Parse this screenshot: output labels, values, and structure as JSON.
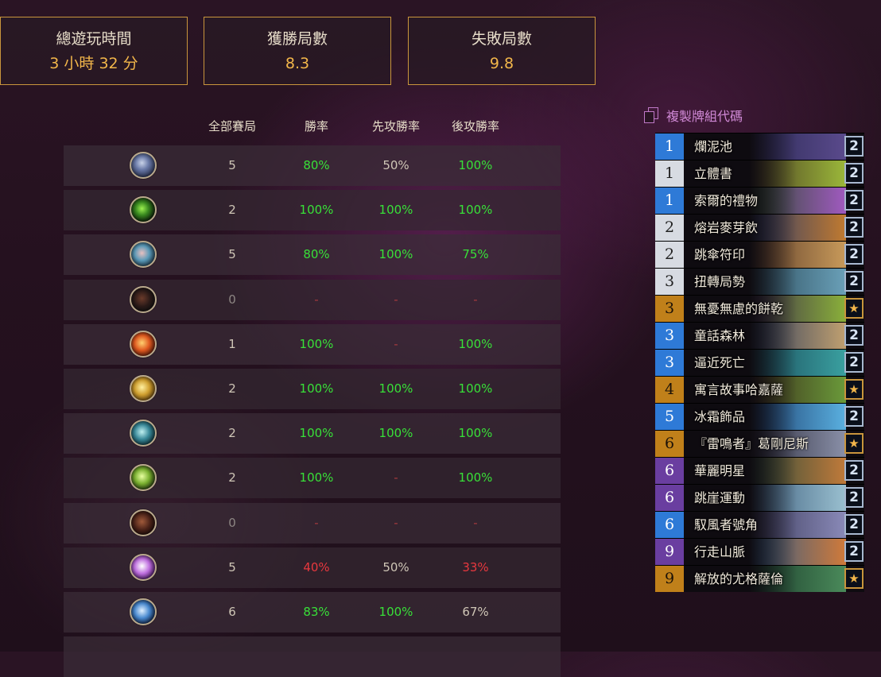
{
  "summary": {
    "total_time": {
      "label": "總遊玩時間",
      "value": "3 小時 32 分"
    },
    "wins": {
      "label": "獲勝局數",
      "value": "8.3"
    },
    "losses": {
      "label": "失敗局數",
      "value": "9.8"
    }
  },
  "table": {
    "headers": [
      "全部賽局",
      "勝率",
      "先攻勝率",
      "後攻勝率"
    ],
    "rows": [
      {
        "icon": "warrior-class-icon",
        "games": "5",
        "winrate": "80%",
        "first": "50%",
        "second": "100%"
      },
      {
        "icon": "druid-class-icon",
        "games": "2",
        "winrate": "100%",
        "first": "100%",
        "second": "100%"
      },
      {
        "icon": "shaman-class-icon",
        "games": "5",
        "winrate": "80%",
        "first": "100%",
        "second": "75%"
      },
      {
        "icon": "rogue-class-icon",
        "games": "0",
        "winrate": "-",
        "first": "-",
        "second": "-"
      },
      {
        "icon": "mage-class-icon",
        "games": "1",
        "winrate": "100%",
        "first": "-",
        "second": "100%"
      },
      {
        "icon": "paladin-class-icon",
        "games": "2",
        "winrate": "100%",
        "first": "100%",
        "second": "100%"
      },
      {
        "icon": "hunter-class-icon",
        "games": "2",
        "winrate": "100%",
        "first": "100%",
        "second": "100%"
      },
      {
        "icon": "demon-hunter-class-icon",
        "games": "2",
        "winrate": "100%",
        "first": "-",
        "second": "100%"
      },
      {
        "icon": "warlock-class-icon",
        "games": "0",
        "winrate": "-",
        "first": "-",
        "second": "-"
      },
      {
        "icon": "priest-class-icon",
        "games": "5",
        "winrate": "40%",
        "first": "50%",
        "second": "33%"
      },
      {
        "icon": "death-knight-class-icon",
        "games": "6",
        "winrate": "83%",
        "first": "100%",
        "second": "67%"
      }
    ]
  },
  "deck": {
    "copy_label": "複製牌組代碼",
    "cards": [
      {
        "cost": "1",
        "name": "爛泥池",
        "count": "2",
        "rarity": "blue",
        "art": [
          "#2b2a55",
          "#5a4a8c"
        ]
      },
      {
        "cost": "1",
        "name": "立體書",
        "count": "2",
        "rarity": "white",
        "art": [
          "#4a3a22",
          "#9bb83a"
        ]
      },
      {
        "cost": "1",
        "name": "索爾的禮物",
        "count": "2",
        "rarity": "blue",
        "art": [
          "#2a4a2a",
          "#a05ac0"
        ]
      },
      {
        "cost": "2",
        "name": "熔岩麥芽飲",
        "count": "2",
        "rarity": "white",
        "art": [
          "#2a3a6a",
          "#c07a30"
        ]
      },
      {
        "cost": "2",
        "name": "跳傘符印",
        "count": "2",
        "rarity": "white",
        "art": [
          "#5a3a28",
          "#c89a5a"
        ]
      },
      {
        "cost": "3",
        "name": "扭轉局勢",
        "count": "2",
        "rarity": "white",
        "art": [
          "#2a4a5a",
          "#6aa0b8"
        ]
      },
      {
        "cost": "3",
        "name": "無憂無慮的餅乾",
        "count": "★",
        "rarity": "orange",
        "art": [
          "#3a2a4a",
          "#8ab03a"
        ]
      },
      {
        "cost": "3",
        "name": "童話森林",
        "count": "2",
        "rarity": "blue",
        "art": [
          "#2a3a5a",
          "#c0a070"
        ]
      },
      {
        "cost": "3",
        "name": "逼近死亡",
        "count": "2",
        "rarity": "blue",
        "art": [
          "#1a4a5a",
          "#3aa0a0"
        ]
      },
      {
        "cost": "4",
        "name": "寓言故事哈嘉薩",
        "count": "★",
        "rarity": "orange",
        "art": [
          "#3a2a1a",
          "#6a9a3a"
        ]
      },
      {
        "cost": "5",
        "name": "冰霜飾品",
        "count": "2",
        "rarity": "blue",
        "art": [
          "#1a3a6a",
          "#5ab0e0"
        ]
      },
      {
        "cost": "6",
        "name": "『雷鳴者』葛剛尼斯",
        "count": "★",
        "rarity": "orange",
        "art": [
          "#2a2a3a",
          "#8a90a8"
        ]
      },
      {
        "cost": "6",
        "name": "華麗明星",
        "count": "2",
        "rarity": "purple",
        "art": [
          "#2a4a3a",
          "#c07a3a"
        ]
      },
      {
        "cost": "6",
        "name": "跳崖運動",
        "count": "2",
        "rarity": "purple",
        "art": [
          "#3a5a7a",
          "#9ac0d0"
        ]
      },
      {
        "cost": "6",
        "name": "馭風者號角",
        "count": "2",
        "rarity": "blue",
        "art": [
          "#3a3a5a",
          "#8a8ab8"
        ]
      },
      {
        "cost": "9",
        "name": "行走山脈",
        "count": "2",
        "rarity": "purple",
        "art": [
          "#2a5a8a",
          "#d07a3a"
        ]
      },
      {
        "cost": "9",
        "name": "解放的尤格薩倫",
        "count": "★",
        "rarity": "orange",
        "art": [
          "#1a3a2a",
          "#4a8a5a"
        ]
      }
    ]
  },
  "colors": {
    "accent": "#f2b64a",
    "win": "#38e038",
    "loss": "#e8383e",
    "link": "#d089d6"
  }
}
